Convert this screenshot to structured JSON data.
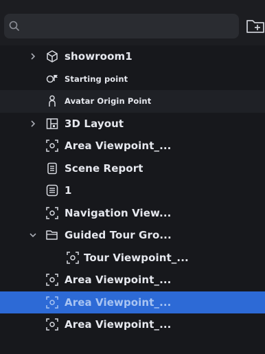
{
  "search": {
    "value": "",
    "placeholder": ""
  },
  "toolbar": {
    "new_folder_icon": "folder-plus-icon"
  },
  "tree": [
    {
      "label": "showroom1",
      "icon": "cube-icon",
      "chevron": "right",
      "size": "normal"
    },
    {
      "label": "Starting point",
      "icon": "starting-point-icon",
      "chevron": "none",
      "size": "small"
    },
    {
      "label": "Avatar Origin Point",
      "icon": "avatar-icon",
      "chevron": "none",
      "size": "small"
    },
    {
      "label": "3D Layout",
      "icon": "layout-icon",
      "chevron": "right",
      "size": "normal"
    },
    {
      "label": "Area Viewpoint_...",
      "icon": "viewpoint-icon",
      "chevron": "none",
      "size": "normal"
    },
    {
      "label": "Scene Report",
      "icon": "report-icon",
      "chevron": "none",
      "size": "normal"
    },
    {
      "label": "1",
      "icon": "note-icon",
      "chevron": "none",
      "size": "normal"
    },
    {
      "label": "Navigation View...",
      "icon": "viewpoint-icon",
      "chevron": "none",
      "size": "normal"
    },
    {
      "label": "Guided Tour Gro...",
      "icon": "folder-icon",
      "chevron": "down",
      "size": "normal"
    },
    {
      "label": "Tour Viewpoint_...",
      "icon": "viewpoint-icon",
      "chevron": "none",
      "size": "normal"
    },
    {
      "label": "Area Viewpoint_...",
      "icon": "viewpoint-icon",
      "chevron": "none",
      "size": "normal"
    },
    {
      "label": "Area Viewpoint_...",
      "icon": "viewpoint-icon",
      "chevron": "none",
      "size": "normal",
      "selected": true
    },
    {
      "label": "Area Viewpoint_...",
      "icon": "viewpoint-icon",
      "chevron": "none",
      "size": "normal"
    }
  ],
  "colors": {
    "background": "#17181c",
    "selection": "#2d6ad6",
    "search_bg": "#2a2c31",
    "text": "#e6e8ee"
  }
}
